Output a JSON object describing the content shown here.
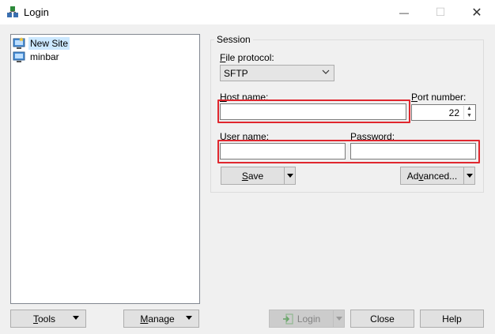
{
  "window": {
    "title": "Login",
    "min_glyph": "—",
    "max_glyph": "☐",
    "close_glyph": "✕"
  },
  "sites": [
    {
      "label": "New Site",
      "selected": true,
      "icon": "new-site-icon"
    },
    {
      "label": "minbar",
      "selected": false,
      "icon": "computer-icon"
    }
  ],
  "session": {
    "group_title": "Session",
    "file_protocol_label_u": "F",
    "file_protocol_label_rest": "ile protocol:",
    "file_protocol_value": "SFTP",
    "host_label_u": "H",
    "host_label_rest": "ost name:",
    "host_value": "",
    "port_label_u": "P",
    "port_label_rest": "ort number:",
    "port_value": "22",
    "user_label_u": "U",
    "user_label_rest": "ser name:",
    "user_value": "",
    "password_label_u": "P",
    "password_label_rest": "assword:",
    "password_value": "",
    "save_u": "S",
    "save_rest": "ave",
    "advanced_pre": "Ad",
    "advanced_u": "v",
    "advanced_rest": "anced..."
  },
  "bottom": {
    "tools_u": "T",
    "tools_rest": "ools",
    "manage_u": "M",
    "manage_rest": "anage",
    "login": "Login",
    "close": "Close",
    "help": "Help"
  },
  "colors": {
    "highlight": "#e0272e",
    "selection": "#cce8ff"
  }
}
